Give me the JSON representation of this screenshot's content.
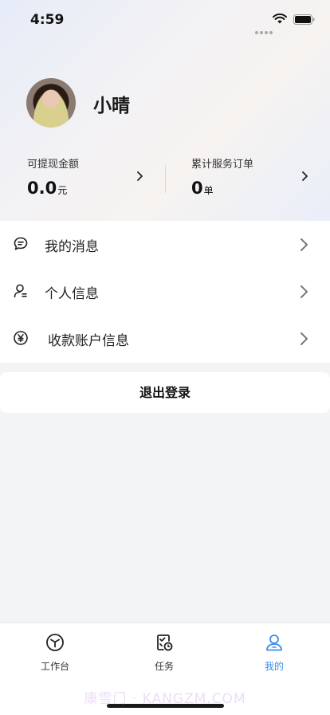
{
  "status_bar": {
    "time": "4:59"
  },
  "profile": {
    "name": "小晴"
  },
  "stats": {
    "withdrawable": {
      "label": "可提现金额",
      "value": "0.0",
      "unit": "元"
    },
    "orders": {
      "label": "累计服务订单",
      "value": "0",
      "unit": "单"
    }
  },
  "menu": {
    "items": [
      {
        "label": "我的消息",
        "icon": "message-icon"
      },
      {
        "label": "个人信息",
        "icon": "user-card-icon"
      },
      {
        "label": "收款账户信息",
        "icon": "yen-icon"
      }
    ]
  },
  "logout": {
    "label": "退出登录"
  },
  "tabbar": {
    "tabs": [
      {
        "label": "工作台",
        "icon": "workbench-icon",
        "active": false
      },
      {
        "label": "任务",
        "icon": "task-icon",
        "active": false
      },
      {
        "label": "我的",
        "icon": "profile-icon",
        "active": true
      }
    ]
  },
  "watermark": "康雪门 · KANGZM.COM",
  "colors": {
    "accent": "#3b8df0",
    "background": "#f3f4f6"
  }
}
